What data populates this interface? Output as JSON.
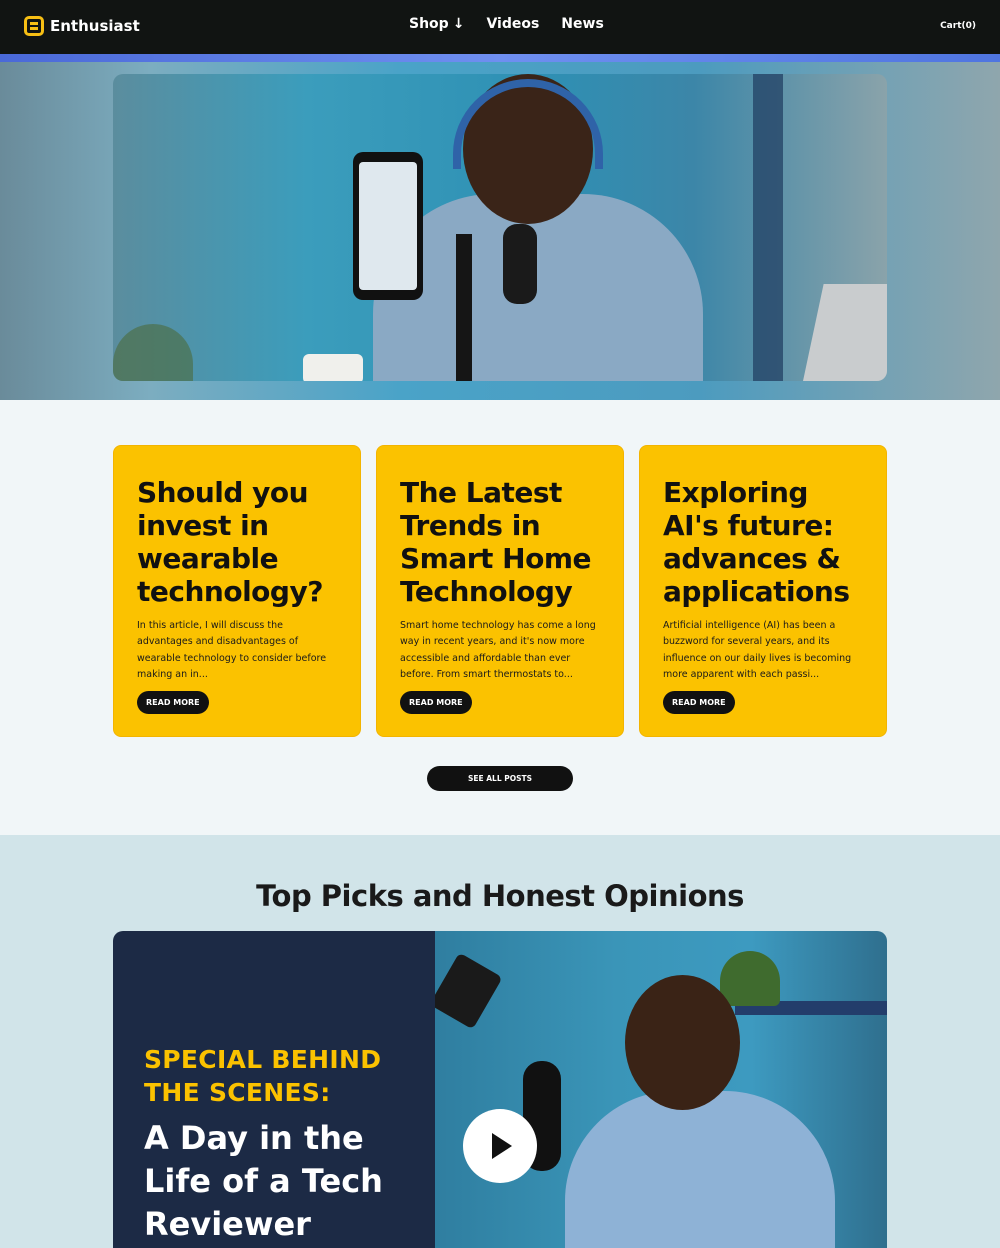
{
  "nav": {
    "logo": "Enthusiast",
    "links": [
      "Shop",
      "Videos",
      "News"
    ],
    "shop_arrow": "↓",
    "cart": "Cart(0)"
  },
  "posts": [
    {
      "title": "Should you invest in wearable technology?",
      "excerpt": "In this article, I will discuss the advantages and disadvantages of wearable technology to consider before making an in...",
      "button": "READ MORE"
    },
    {
      "title": "The Latest Trends in Smart Home Technology",
      "excerpt": "Smart home technology has come a long way in recent years, and it's now more accessible and affordable than ever before. From smart thermostats to...",
      "button": "READ MORE"
    },
    {
      "title": "Exploring AI's future: advances & applications",
      "excerpt": "Artificial intelligence (AI) has been a buzzword for several years, and its influence on our daily lives is becoming more apparent with each passi...",
      "button": "READ MORE"
    }
  ],
  "see_all": "SEE ALL POSTS",
  "picks": {
    "title": "Top Picks and Honest Opinions",
    "kicker": "SPECIAL BEHIND THE SCENES:",
    "feature_title": "A Day in the Life of a Tech Reviewer"
  },
  "colors": {
    "accent": "#fbc200",
    "nav_bg": "#111412",
    "feature_bg": "#1c2a45"
  }
}
